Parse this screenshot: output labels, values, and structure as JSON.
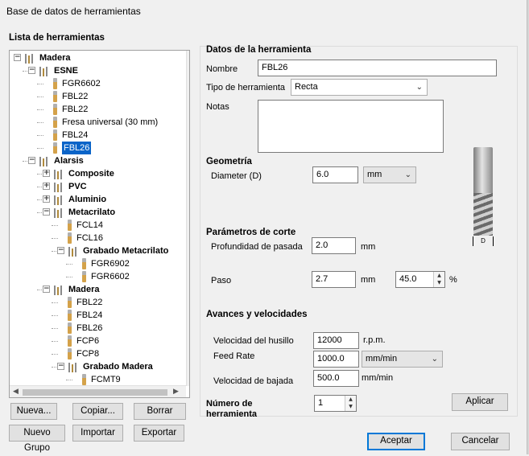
{
  "window": {
    "title": "Base de datos de herramientas"
  },
  "tree": {
    "heading": "Lista de herramientas",
    "rows": [
      {
        "label": "Madera",
        "kind": "folder",
        "bold": true,
        "expander": "−"
      },
      {
        "label": "ESNE",
        "kind": "folder",
        "bold": true,
        "expander": "−"
      },
      {
        "label": "FGR6602",
        "kind": "tool"
      },
      {
        "label": "FBL22",
        "kind": "tool"
      },
      {
        "label": "FBL22",
        "kind": "tool"
      },
      {
        "label": "Fresa universal (30 mm)",
        "kind": "tool"
      },
      {
        "label": "FBL24",
        "kind": "tool"
      },
      {
        "label": "FBL26",
        "kind": "tool",
        "selected": true
      },
      {
        "label": "Alarsis",
        "kind": "folder",
        "bold": true,
        "expander": "−"
      },
      {
        "label": "Composite",
        "kind": "folder",
        "bold": true,
        "expander": "+"
      },
      {
        "label": "PVC",
        "kind": "folder",
        "bold": true,
        "expander": "+"
      },
      {
        "label": "Aluminio",
        "kind": "folder",
        "bold": true,
        "expander": "+"
      },
      {
        "label": "Metacrilato",
        "kind": "folder",
        "bold": true,
        "expander": "−"
      },
      {
        "label": "FCL14",
        "kind": "tool"
      },
      {
        "label": "FCL16",
        "kind": "tool"
      },
      {
        "label": "Grabado Metacrilato",
        "kind": "folder",
        "bold": true,
        "expander": "−"
      },
      {
        "label": "FGR6902",
        "kind": "tool"
      },
      {
        "label": "FGR6602",
        "kind": "tool"
      },
      {
        "label": "Madera",
        "kind": "folder",
        "bold": true,
        "expander": "−"
      },
      {
        "label": "FBL22",
        "kind": "tool"
      },
      {
        "label": "FBL24",
        "kind": "tool"
      },
      {
        "label": "FBL26",
        "kind": "tool"
      },
      {
        "label": "FCP6",
        "kind": "tool"
      },
      {
        "label": "FCP8",
        "kind": "tool"
      },
      {
        "label": "Grabado Madera",
        "kind": "folder",
        "bold": true,
        "expander": "−"
      },
      {
        "label": "FCMT9",
        "kind": "tool"
      }
    ]
  },
  "left_buttons": {
    "nueva": "Nueva...",
    "copiar": "Copiar...",
    "borrar": "Borrar",
    "nuevo_grupo": "Nuevo Grupo",
    "importar": "Importar",
    "exportar": "Exportar"
  },
  "tool_data": {
    "heading": "Datos de la herramienta",
    "nombre_label": "Nombre",
    "nombre_value": "FBL26",
    "tipo_label": "Tipo de herramienta",
    "tipo_value": "Recta",
    "notas_label": "Notas",
    "notas_value": ""
  },
  "geometria": {
    "heading": "Geometría",
    "diameter_label": "Diameter (D)",
    "diameter_value": "6.0",
    "unit_value": "mm",
    "dim_label": "D"
  },
  "corte": {
    "heading": "Parámetros de corte",
    "profundidad_label": "Profundidad de pasada",
    "profundidad_value": "2.0",
    "profundidad_unit": "mm",
    "paso_label": "Paso",
    "paso_value": "2.7",
    "paso_unit": "mm",
    "paso_pct_value": "45.0",
    "paso_pct_unit": "%"
  },
  "avances": {
    "heading": "Avances y velocidades",
    "husillo_label": "Velocidad del husillo",
    "husillo_value": "12000",
    "husillo_unit": "r.p.m.",
    "feed_label": "Feed Rate",
    "feed_value": "1000.0",
    "feed_unit": "mm/min",
    "bajada_label": "Velocidad de bajada",
    "bajada_value": "500.0",
    "bajada_unit": "mm/min"
  },
  "numero": {
    "label": "Número de herramienta",
    "value": "1"
  },
  "actions": {
    "aplicar": "Aplicar",
    "aceptar": "Aceptar",
    "cancelar": "Cancelar"
  }
}
